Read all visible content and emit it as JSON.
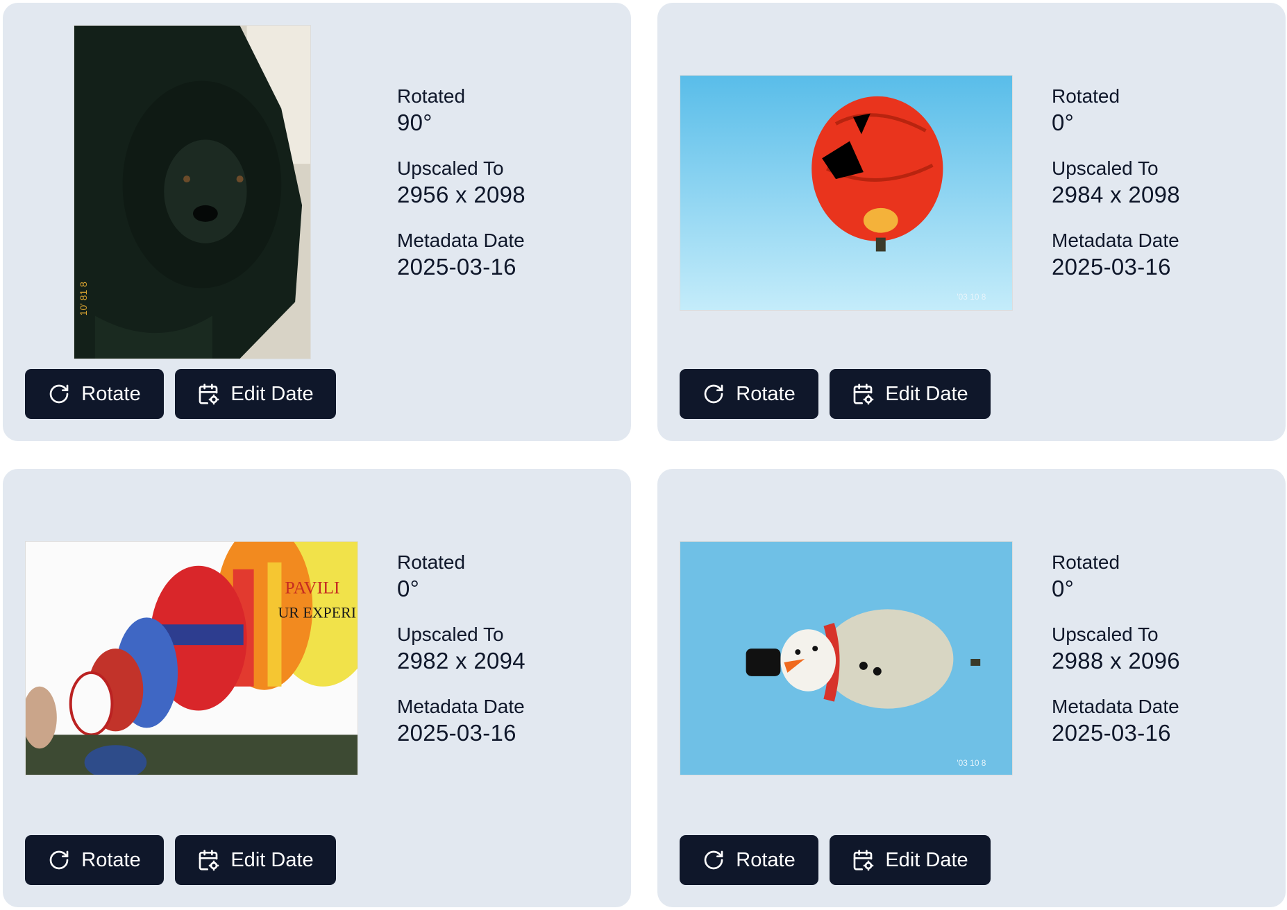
{
  "cards": [
    {
      "photo": "black-dog-photo",
      "rotated_label": "Rotated",
      "rotated_value": "90°",
      "upscaled_label": "Upscaled To",
      "upscaled_value": "2956 x 2098",
      "date_label": "Metadata Date",
      "date_value": "2025-03-16",
      "rotate_label": "Rotate",
      "edit_date_label": "Edit Date"
    },
    {
      "photo": "pumpkin-balloon-photo",
      "rotated_label": "Rotated",
      "rotated_value": "0°",
      "upscaled_label": "Upscaled To",
      "upscaled_value": "2984 x 2098",
      "date_label": "Metadata Date",
      "date_value": "2025-03-16",
      "rotate_label": "Rotate",
      "edit_date_label": "Edit Date"
    },
    {
      "photo": "balloon-fiesta-photo",
      "rotated_label": "Rotated",
      "rotated_value": "0°",
      "upscaled_label": "Upscaled To",
      "upscaled_value": "2982 x 2094",
      "date_label": "Metadata Date",
      "date_value": "2025-03-16",
      "rotate_label": "Rotate",
      "edit_date_label": "Edit Date"
    },
    {
      "photo": "snowman-balloon-photo",
      "rotated_label": "Rotated",
      "rotated_value": "0°",
      "upscaled_label": "Upscaled To",
      "upscaled_value": "2988 x 2096",
      "date_label": "Metadata Date",
      "date_value": "2025-03-16",
      "rotate_label": "Rotate",
      "edit_date_label": "Edit Date"
    }
  ],
  "icons": {
    "rotate": "rotate-cw-icon",
    "edit_date": "calendar-cog-icon"
  },
  "colors": {
    "card_bg": "#e2e8f0",
    "button_bg": "#0f172a",
    "text": "#0f172a"
  }
}
